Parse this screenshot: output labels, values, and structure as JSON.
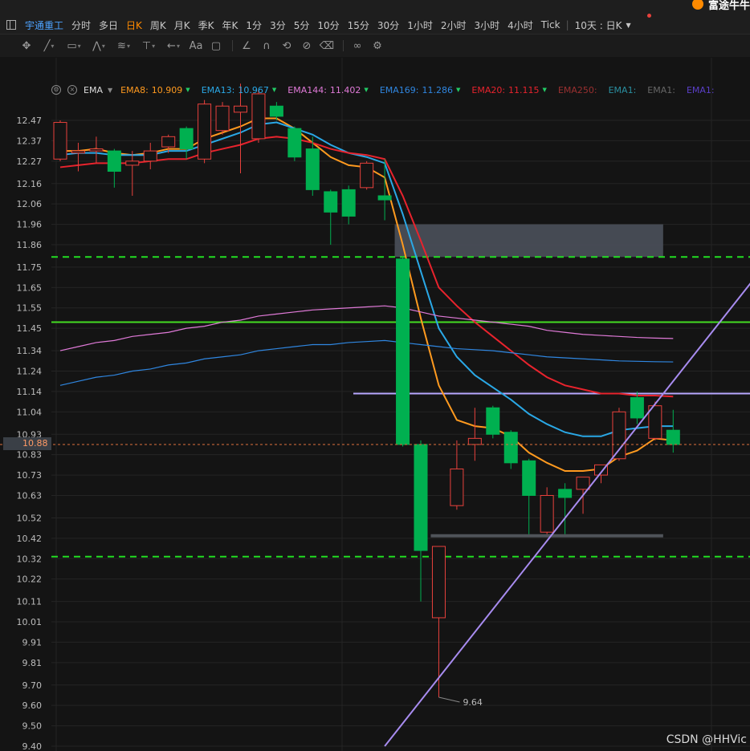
{
  "app": {
    "logo_text": "富途牛牛"
  },
  "timeframes": {
    "stock_name": "宇通重工",
    "items": [
      "分时",
      "多日",
      "日K",
      "周K",
      "月K",
      "季K",
      "年K",
      "1分",
      "3分",
      "5分",
      "10分",
      "15分",
      "30分",
      "1小时",
      "2小时",
      "3小时",
      "4小时",
      "Tick"
    ],
    "active": "日K",
    "range_select": "10天 : 日K"
  },
  "toolbar": {
    "tools": [
      "move-tool-icon",
      "line-tool-icon",
      "rectangle-tool-icon",
      "pattern-tool-icon",
      "fibonacci-tool-icon",
      "price-level-tool-icon",
      "arrow-tool-icon",
      "text-tool-icon",
      "comment-tool-icon",
      "angle-tool-icon",
      "magnet-icon",
      "sync-icon",
      "hide-icon",
      "trash-icon",
      "link-icon",
      "settings-icon"
    ]
  },
  "ema": {
    "label": "EMA",
    "series": [
      {
        "name": "EMA8:",
        "value": "10.909",
        "color": "#ff9a1f"
      },
      {
        "name": "EMA13:",
        "value": "10.967",
        "color": "#2aa8e6"
      },
      {
        "name": "EMA144:",
        "value": "11.402",
        "color": "#e07ad8"
      },
      {
        "name": "EMA169:",
        "value": "11.286",
        "color": "#2f86e0"
      },
      {
        "name": "EMA20:",
        "value": "11.115",
        "color": "#e8232d"
      },
      {
        "name": "EMA250:",
        "value": "",
        "color": "#9a3030"
      },
      {
        "name": "EMA1:",
        "value": "",
        "color": "#2a8fa0"
      },
      {
        "name": "EMA1:",
        "value": "",
        "color": "#666666"
      },
      {
        "name": "EMA1:",
        "value": "",
        "color": "#5a3fc8"
      }
    ]
  },
  "chart_data": {
    "type": "candlestick",
    "y_ticks": [
      "12.47",
      "12.37",
      "12.27",
      "12.16",
      "12.06",
      "11.96",
      "11.86",
      "11.75",
      "11.65",
      "11.55",
      "11.45",
      "11.34",
      "11.24",
      "11.14",
      "11.04",
      "10.93",
      "10.83",
      "10.73",
      "10.63",
      "10.52",
      "10.42",
      "10.32",
      "10.22",
      "10.11",
      "10.01",
      "9.91",
      "9.81",
      "9.70",
      "9.60",
      "9.50",
      "9.40"
    ],
    "ylim": [
      9.4,
      12.47
    ],
    "current_price": "10.88",
    "low_label": "9.64",
    "low_value": 9.64,
    "candles": [
      {
        "o": 12.28,
        "h": 12.47,
        "l": 12.27,
        "c": 12.46
      },
      {
        "o": 12.31,
        "h": 12.36,
        "l": 12.22,
        "c": 12.32
      },
      {
        "o": 12.32,
        "h": 12.39,
        "l": 12.26,
        "c": 12.33
      },
      {
        "o": 12.32,
        "h": 12.33,
        "l": 12.14,
        "c": 12.22
      },
      {
        "o": 12.25,
        "h": 12.32,
        "l": 12.1,
        "c": 12.27
      },
      {
        "o": 12.27,
        "h": 12.36,
        "l": 12.23,
        "c": 12.32
      },
      {
        "o": 12.34,
        "h": 12.4,
        "l": 12.31,
        "c": 12.39
      },
      {
        "o": 12.43,
        "h": 12.44,
        "l": 12.28,
        "c": 12.33
      },
      {
        "o": 12.28,
        "h": 12.57,
        "l": 12.26,
        "c": 12.55
      },
      {
        "o": 12.42,
        "h": 12.56,
        "l": 12.4,
        "c": 12.54
      },
      {
        "o": 12.51,
        "h": 12.65,
        "l": 12.21,
        "c": 12.54
      },
      {
        "o": 12.38,
        "h": 12.62,
        "l": 12.36,
        "c": 12.6
      },
      {
        "o": 12.54,
        "h": 12.56,
        "l": 12.47,
        "c": 12.49
      },
      {
        "o": 12.43,
        "h": 12.44,
        "l": 12.27,
        "c": 12.29
      },
      {
        "o": 12.33,
        "h": 12.39,
        "l": 12.1,
        "c": 12.13
      },
      {
        "o": 12.12,
        "h": 12.13,
        "l": 11.86,
        "c": 12.02
      },
      {
        "o": 12.13,
        "h": 12.15,
        "l": 11.96,
        "c": 12.0
      },
      {
        "o": 12.14,
        "h": 12.27,
        "l": 12.13,
        "c": 12.26
      },
      {
        "o": 12.1,
        "h": 12.28,
        "l": 11.98,
        "c": 12.08
      },
      {
        "o": 11.79,
        "h": 11.8,
        "l": 10.87,
        "c": 10.88
      },
      {
        "o": 10.88,
        "h": 10.9,
        "l": 10.11,
        "c": 10.36
      },
      {
        "o": 10.03,
        "h": 10.38,
        "l": 9.64,
        "c": 10.38
      },
      {
        "o": 10.58,
        "h": 10.9,
        "l": 10.56,
        "c": 10.76
      },
      {
        "o": 10.88,
        "h": 11.06,
        "l": 10.8,
        "c": 10.91
      },
      {
        "o": 11.06,
        "h": 11.07,
        "l": 10.91,
        "c": 10.93
      },
      {
        "o": 10.94,
        "h": 10.95,
        "l": 10.76,
        "c": 10.79
      },
      {
        "o": 10.8,
        "h": 10.81,
        "l": 10.44,
        "c": 10.63
      },
      {
        "o": 10.45,
        "h": 10.67,
        "l": 10.44,
        "c": 10.63
      },
      {
        "o": 10.66,
        "h": 10.69,
        "l": 10.44,
        "c": 10.62
      },
      {
        "o": 10.66,
        "h": 10.72,
        "l": 10.54,
        "c": 10.72
      },
      {
        "o": 10.73,
        "h": 10.78,
        "l": 10.69,
        "c": 10.78
      },
      {
        "o": 10.81,
        "h": 11.06,
        "l": 10.8,
        "c": 11.04
      },
      {
        "o": 11.11,
        "h": 11.14,
        "l": 10.98,
        "c": 11.01
      },
      {
        "o": 10.91,
        "h": 11.09,
        "l": 10.9,
        "c": 11.07
      },
      {
        "o": 10.95,
        "h": 11.05,
        "l": 10.84,
        "c": 10.88
      }
    ],
    "ema_lines": [
      {
        "name": "EMA8",
        "color": "#ff9a1f",
        "values": [
          12.32,
          12.32,
          12.33,
          12.31,
          12.3,
          12.31,
          12.33,
          12.33,
          12.38,
          12.41,
          12.44,
          12.48,
          12.48,
          12.43,
          12.36,
          12.29,
          12.25,
          12.24,
          12.19,
          11.86,
          11.5,
          11.17,
          11.0,
          10.97,
          10.96,
          10.92,
          10.84,
          10.79,
          10.75,
          10.75,
          10.76,
          10.82,
          10.85,
          10.91,
          10.9
        ]
      },
      {
        "name": "EMA13",
        "color": "#2aa8e6",
        "values": [
          12.3,
          12.31,
          12.31,
          12.3,
          12.3,
          12.3,
          12.32,
          12.32,
          12.35,
          12.38,
          12.41,
          12.45,
          12.46,
          12.43,
          12.4,
          12.35,
          12.31,
          12.29,
          12.26,
          12.01,
          11.73,
          11.45,
          11.31,
          11.22,
          11.16,
          11.1,
          11.03,
          10.98,
          10.94,
          10.92,
          10.92,
          10.95,
          10.96,
          10.97,
          10.97
        ]
      },
      {
        "name": "EMA20",
        "color": "#e8232d",
        "values": [
          12.24,
          12.25,
          12.26,
          12.26,
          12.26,
          12.27,
          12.28,
          12.28,
          12.31,
          12.33,
          12.35,
          12.38,
          12.39,
          12.38,
          12.36,
          12.33,
          12.31,
          12.3,
          12.28,
          12.1,
          11.88,
          11.65,
          11.56,
          11.48,
          11.41,
          11.34,
          11.27,
          11.21,
          11.17,
          11.15,
          11.13,
          11.13,
          11.12,
          11.12,
          11.115
        ]
      },
      {
        "name": "EMA144",
        "color": "#e07ad8",
        "values": [
          11.34,
          11.36,
          11.38,
          11.39,
          11.41,
          11.42,
          11.43,
          11.45,
          11.46,
          11.48,
          11.49,
          11.51,
          11.52,
          11.53,
          11.54,
          11.545,
          11.55,
          11.555,
          11.56,
          11.55,
          11.53,
          11.51,
          11.5,
          11.49,
          11.48,
          11.47,
          11.46,
          11.44,
          11.43,
          11.42,
          11.415,
          11.41,
          11.405,
          11.402,
          11.4
        ]
      },
      {
        "name": "EMA169",
        "color": "#2f86e0",
        "values": [
          11.17,
          11.19,
          11.21,
          11.22,
          11.24,
          11.25,
          11.27,
          11.28,
          11.3,
          11.31,
          11.32,
          11.34,
          11.35,
          11.36,
          11.37,
          11.37,
          11.38,
          11.385,
          11.39,
          11.38,
          11.37,
          11.36,
          11.35,
          11.345,
          11.34,
          11.33,
          11.32,
          11.31,
          11.305,
          11.3,
          11.295,
          11.29,
          11.288,
          11.286,
          11.285
        ]
      }
    ],
    "horizontal_levels": [
      {
        "value": 11.8,
        "style": "dashed",
        "color": "#22dd22"
      },
      {
        "value": 10.33,
        "style": "dashed",
        "color": "#22dd22"
      },
      {
        "value": 11.48,
        "style": "solid",
        "color": "#44dd22"
      },
      {
        "value": 11.13,
        "style": "solid",
        "color": "#b8a8ff"
      }
    ],
    "zones": [
      {
        "from_candle": 19,
        "to_candle": 33,
        "low": 11.8,
        "high": 11.96,
        "color": "#4a505a"
      },
      {
        "from_candle": 21,
        "to_candle": 33,
        "low": 10.425,
        "high": 10.44,
        "color": "#555a60"
      }
    ],
    "trendline": {
      "color": "#a88cf0",
      "start": {
        "candle": 18,
        "value": 9.4
      },
      "end": {
        "candle": 39,
        "value": 11.75
      }
    },
    "colors": {
      "up": "#e8413c",
      "down": "#00b050",
      "grid": "#242424",
      "axis_text": "#bcbcbc"
    }
  },
  "watermark": "CSDN @HHVic"
}
